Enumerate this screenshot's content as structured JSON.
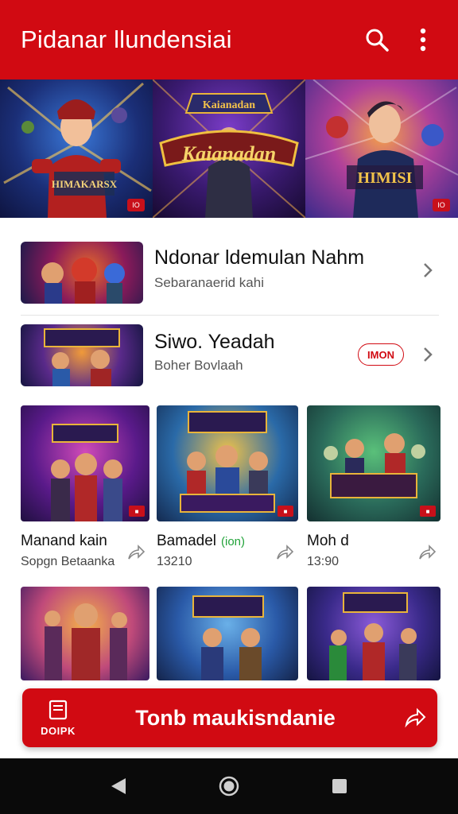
{
  "app": {
    "title": "Pidanar llundensiai",
    "accent": "#d10a12"
  },
  "appbar_icons": [
    "search-icon",
    "more-vert-icon"
  ],
  "hero": [
    {
      "name": "hero-tile-warrior",
      "badge": "IO"
    },
    {
      "name": "hero-tile-logo",
      "badge": ""
    },
    {
      "name": "hero-tile-hero",
      "badge": "IO"
    }
  ],
  "hero_art_text": [
    "HIMAKARSX",
    "Kaianadan",
    "HIMISI"
  ],
  "list": [
    {
      "title": "Ndonar ldemulan Nahm",
      "subtitle": "Sebaranaerid kahi",
      "badge": ""
    },
    {
      "title": "Siwo. Yeadah",
      "subtitle": "Boher Bovlaah",
      "badge": "IMON"
    }
  ],
  "grid": [
    {
      "title": "Manand kain",
      "subtitle": "Sopgn Betaanka",
      "tag": ""
    },
    {
      "title": "Bamadel",
      "subtitle": "13210",
      "tag": "(ion)"
    },
    {
      "title": "Moh d",
      "subtitle": "13:90",
      "tag": ""
    },
    {
      "title": "",
      "subtitle": "",
      "tag": ""
    },
    {
      "title": "",
      "subtitle": "",
      "tag": ""
    },
    {
      "title": "",
      "subtitle": "",
      "tag": ""
    }
  ],
  "cta": {
    "left_label": "DOIPK",
    "label": "Tonb maukisndanie"
  },
  "nav": [
    "back-icon",
    "home-icon",
    "recents-icon"
  ]
}
